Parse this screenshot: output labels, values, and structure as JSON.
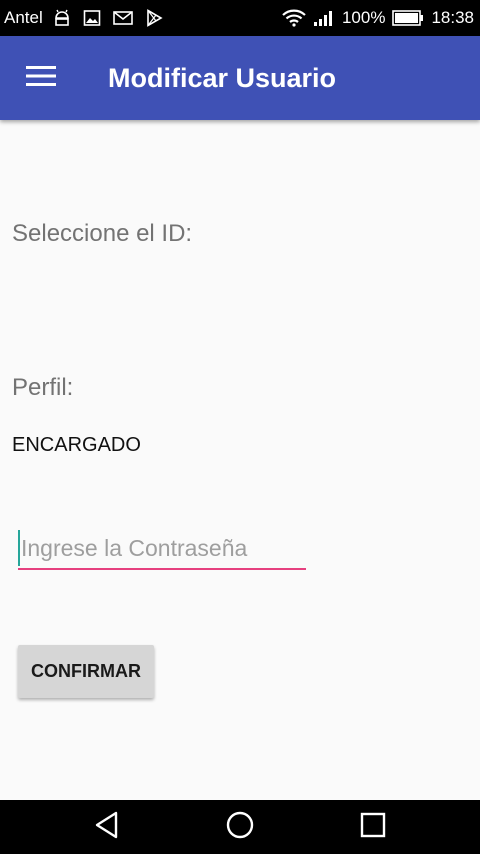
{
  "status_bar": {
    "carrier": "Antel",
    "battery_percent": "100%",
    "time": "18:38",
    "icons": [
      "android-icon",
      "image-icon",
      "mail-icon",
      "play-store-icon",
      "wifi-icon",
      "signal-icon",
      "battery-icon"
    ]
  },
  "app_bar": {
    "title": "Modificar Usuario",
    "menu_icon": "hamburger-menu-icon",
    "color": "#3f51b5"
  },
  "form": {
    "id_label": "Seleccione el ID:",
    "perfil_label": "Perfil:",
    "perfil_value": "ENCARGADO",
    "password_placeholder": "Ingrese la Contraseña",
    "password_value": "",
    "confirm_label": "CONFIRMAR",
    "accent_color": "#e6407f"
  },
  "nav_bar": {
    "icons": [
      "back-icon",
      "home-icon",
      "recents-icon"
    ]
  }
}
